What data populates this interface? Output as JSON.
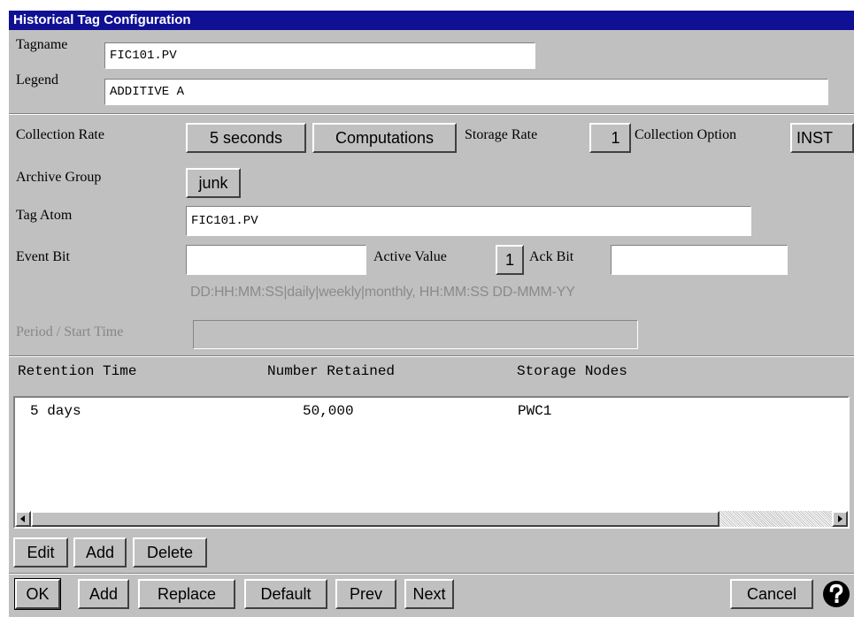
{
  "window": {
    "title": "Historical Tag Configuration"
  },
  "tag": {
    "tagname_label": "Tagname",
    "tagname_value": "FIC101.PV",
    "legend_label": "Legend",
    "legend_value": "ADDITIVE A"
  },
  "collection": {
    "rate_label": "Collection Rate",
    "rate_value": "5 seconds",
    "computations_button": "Computations",
    "storage_rate_label": "Storage Rate",
    "storage_rate_value": "1",
    "option_label": "Collection Option",
    "option_value": "INST",
    "archive_group_label": "Archive Group",
    "archive_group_value": "junk",
    "tag_atom_label": "Tag Atom",
    "tag_atom_value": "FIC101.PV",
    "event_bit_label": "Event Bit",
    "event_bit_value": "",
    "active_value_label": "Active Value",
    "active_value": "1",
    "ack_bit_label": "Ack Bit",
    "ack_bit_value": "",
    "time_format_hint": "DD:HH:MM:SS|daily|weekly|monthly,  HH:MM:SS  DD-MMM-YY",
    "period_label": "Period / Start Time",
    "period_value": ""
  },
  "retention": {
    "columns": [
      "Retention Time",
      "Number Retained",
      "Storage Nodes"
    ],
    "rows": [
      {
        "time": "5 days",
        "retained": "50,000",
        "nodes": "PWC1"
      }
    ],
    "edit_button": "Edit",
    "add_button": "Add",
    "delete_button": "Delete"
  },
  "footer": {
    "ok": "OK",
    "add": "Add",
    "replace": "Replace",
    "default": "Default",
    "prev": "Prev",
    "next": "Next",
    "cancel": "Cancel",
    "help_icon": "help-question-icon"
  },
  "colors": {
    "title_bar": "#101094",
    "dialog_bg": "#c0c0c0",
    "disabled_text": "#868686"
  }
}
